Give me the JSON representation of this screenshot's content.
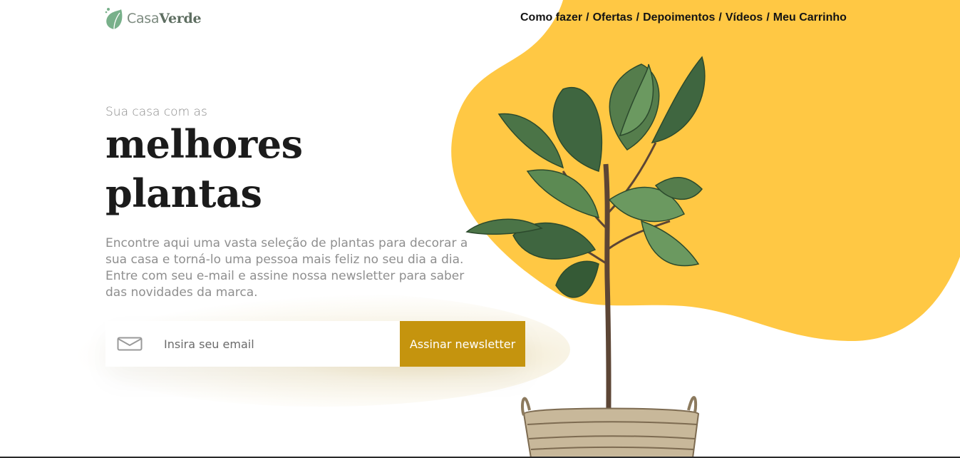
{
  "brand": {
    "name_light": "Casa",
    "name_bold": "Verde",
    "logo_icon": "leaf-icon"
  },
  "nav": {
    "items": [
      {
        "label": "Como fazer"
      },
      {
        "label": "Ofertas"
      },
      {
        "label": "Depoimentos"
      },
      {
        "label": "Vídeos"
      },
      {
        "label": "Meu Carrinho"
      }
    ],
    "separator": "/"
  },
  "hero": {
    "subtitle": "Sua casa com as",
    "title_line1": "melhores",
    "title_line2": "plantas",
    "description": "Encontre aqui uma vasta seleção de plantas para decorar a sua casa e torná-lo uma pessoa mais feliz no seu dia a dia. Entre com seu e-mail e assine nossa newsletter para saber das novidades da marca."
  },
  "newsletter": {
    "icon": "mail-icon",
    "placeholder": "Insira seu email",
    "button_label": "Assinar newsletter"
  },
  "colors": {
    "accent_yellow": "#ffc844",
    "button_gold": "#c5940e",
    "logo_green": "#78b08a",
    "title_dark": "#1b1b1b",
    "body_gray": "#8f8f8f"
  },
  "media": {
    "plant_image": "potted-fiddle-leaf-fig"
  }
}
